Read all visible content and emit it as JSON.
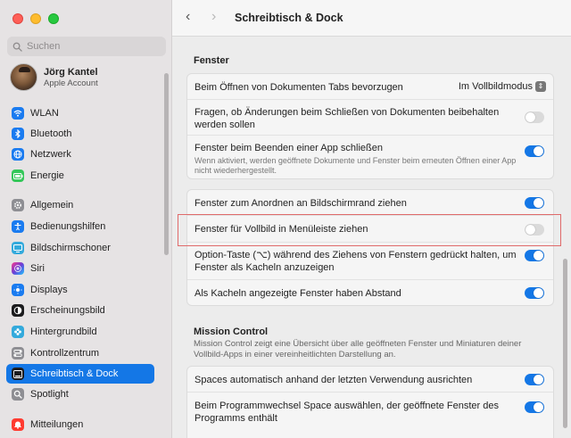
{
  "window": {
    "title": "Schreibtisch & Dock"
  },
  "sidebar": {
    "search_placeholder": "Suchen",
    "account": {
      "name": "Jörg Kantel",
      "subtitle": "Apple Account"
    },
    "items": [
      {
        "label": "WLAN",
        "icon": "wifi-icon",
        "color": "#1a7bf0"
      },
      {
        "label": "Bluetooth",
        "icon": "bluetooth-icon",
        "color": "#1a7bf0"
      },
      {
        "label": "Netzwerk",
        "icon": "globe-icon",
        "color": "#1a7bf0"
      },
      {
        "label": "Energie",
        "icon": "battery-icon",
        "color": "#34c759"
      },
      {
        "label": "Allgemein",
        "icon": "gear-icon",
        "color": "#8e8e93"
      },
      {
        "label": "Bedienungshilfen",
        "icon": "accessibility-icon",
        "color": "#1a7bf0"
      },
      {
        "label": "Bildschirmschoner",
        "icon": "screensaver-icon",
        "color": "#34aadc"
      },
      {
        "label": "Siri",
        "icon": "siri-icon",
        "color": "#6a3fd6"
      },
      {
        "label": "Displays",
        "icon": "sun-icon",
        "color": "#1a7bf0"
      },
      {
        "label": "Erscheinungsbild",
        "icon": "appearance-icon",
        "color": "#1c1c1e"
      },
      {
        "label": "Hintergrundbild",
        "icon": "flower-icon",
        "color": "#34aadc"
      },
      {
        "label": "Kontrollzentrum",
        "icon": "controlcenter-icon",
        "color": "#8e8e93"
      },
      {
        "label": "Schreibtisch & Dock",
        "icon": "dock-icon",
        "color": "#1c1c1e"
      },
      {
        "label": "Spotlight",
        "icon": "magnifier-icon",
        "color": "#8e8e93"
      },
      {
        "label": "Mitteilungen",
        "icon": "bell-icon",
        "color": "#ff3b30"
      }
    ]
  },
  "toolbar": {
    "back": "‹",
    "forward": "›",
    "title": "Schreibtisch & Dock"
  },
  "fenster": {
    "title": "Fenster",
    "group1": [
      {
        "label": "Beim Öffnen von Dokumenten Tabs bevorzugen",
        "value": "Im Vollbildmodus"
      },
      {
        "label": "Fragen, ob Änderungen beim Schließen von Dokumenten beibehalten werden sollen",
        "state": "off"
      },
      {
        "label": "Fenster beim Beenden einer App schließen",
        "sub": "Wenn aktiviert, werden geöffnete Dokumente und Fenster beim erneuten Öffnen einer App nicht wiederhergestellt.",
        "state": "on"
      }
    ],
    "group2": [
      {
        "label": "Fenster zum Anordnen an Bildschirmrand ziehen",
        "state": "on"
      },
      {
        "label": "Fenster für Vollbild in Menüleiste ziehen",
        "state": "off"
      },
      {
        "label": "Option-Taste (⌥) während des Ziehens von Fenstern gedrückt halten, um Fenster als Kacheln anzuzeigen",
        "state": "on"
      },
      {
        "label": "Als Kacheln angezeigte Fenster haben Abstand",
        "state": "on"
      }
    ]
  },
  "mission_control": {
    "title": "Mission Control",
    "description": "Mission Control zeigt eine Übersicht über alle geöffneten Fenster und Miniaturen deiner Vollbild-Apps in einer vereinheitlichten Darstellung an.",
    "rows": [
      {
        "label": "Spaces automatisch anhand der letzten Verwendung ausrichten",
        "state": "on"
      },
      {
        "label": "Beim Programmwechsel Space auswählen, der geöffnete Fenster des Programms enthält",
        "state": "on"
      }
    ]
  }
}
